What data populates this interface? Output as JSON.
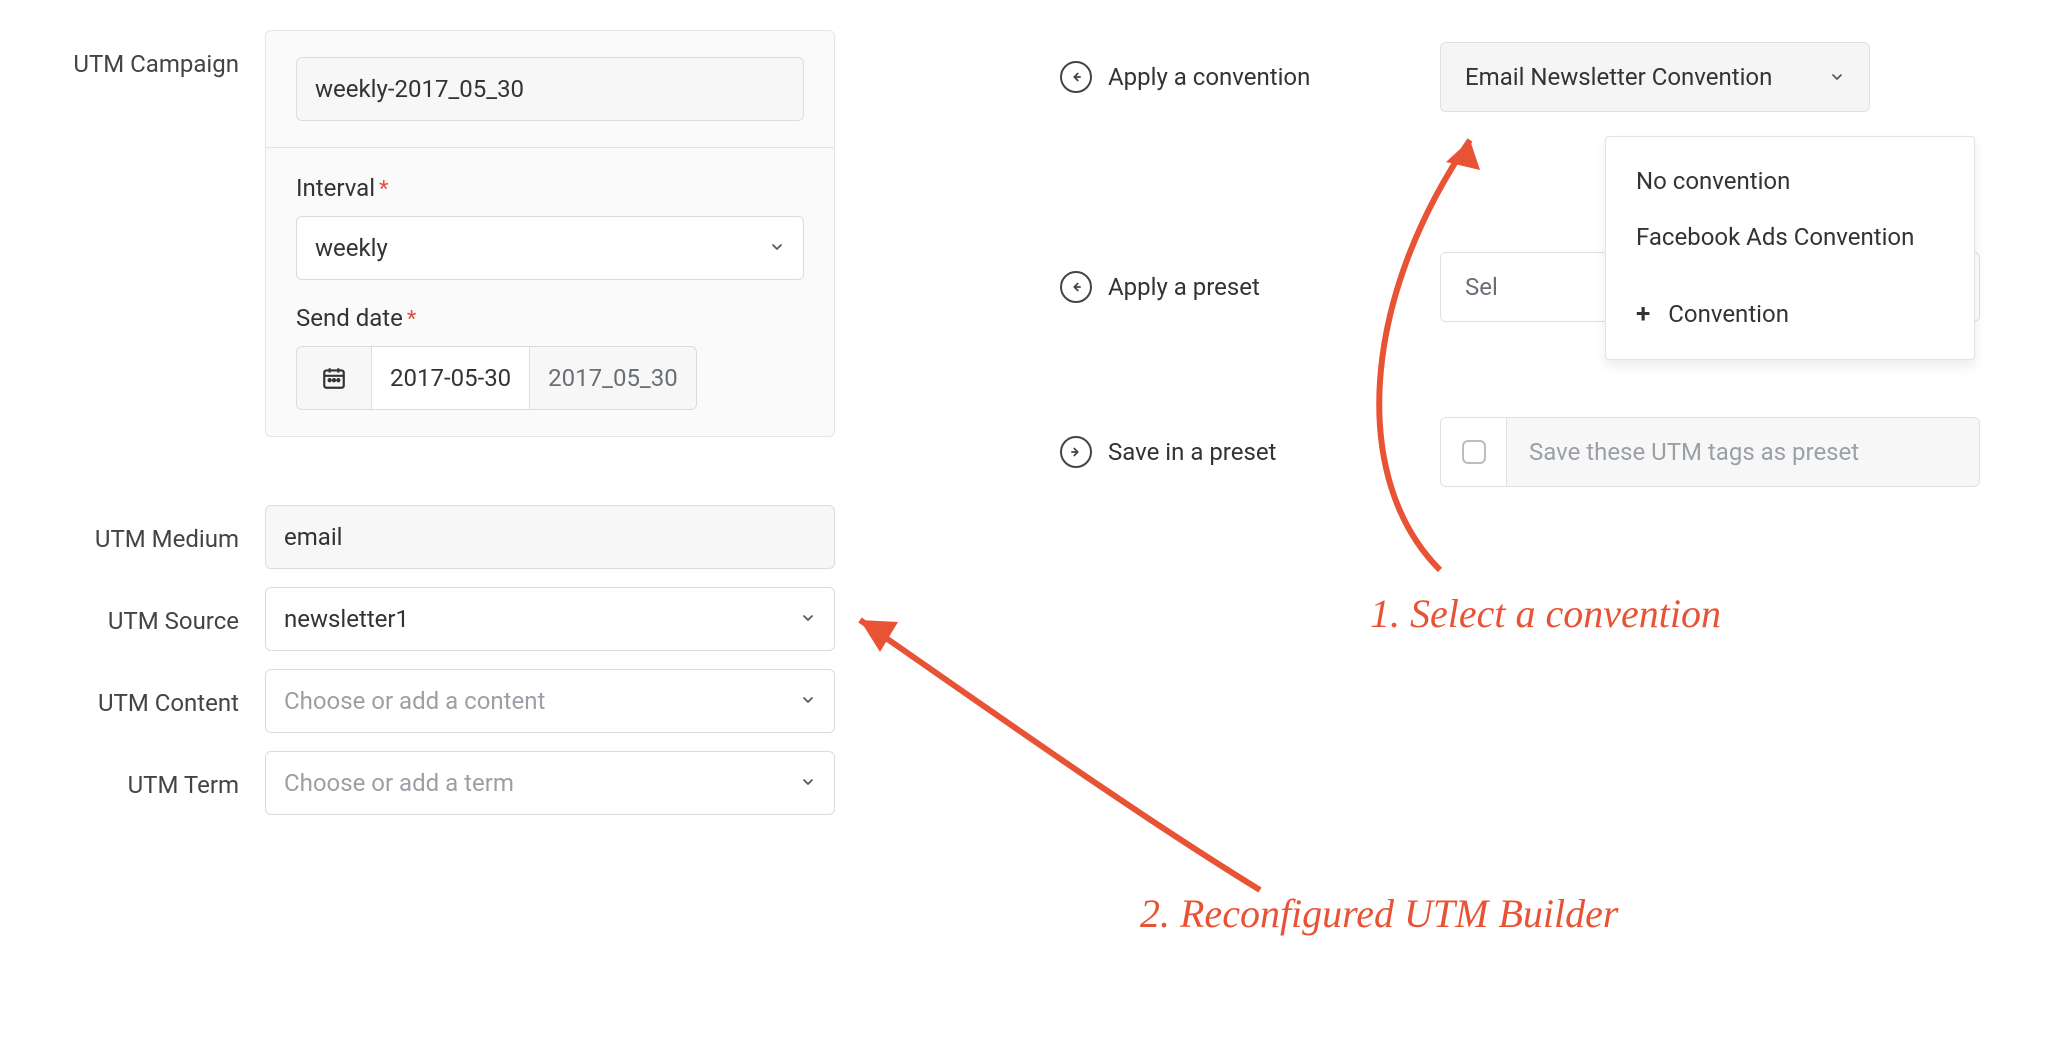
{
  "left": {
    "utm_campaign": {
      "label": "UTM Campaign",
      "value": "weekly-2017_05_30"
    },
    "interval": {
      "label": "Interval",
      "required": "*",
      "value": "weekly"
    },
    "send_date": {
      "label": "Send date",
      "required": "*",
      "date_value": "2017-05-30",
      "formatted": "2017_05_30"
    },
    "medium": {
      "label": "UTM Medium",
      "value": "email"
    },
    "source": {
      "label": "UTM Source",
      "value": "newsletter1"
    },
    "content": {
      "label": "UTM Content",
      "placeholder": "Choose or add a content"
    },
    "term": {
      "label": "UTM Term",
      "placeholder": "Choose or add a term"
    }
  },
  "right": {
    "convention": {
      "label": "Apply a convention",
      "selected": "Email Newsletter Convention",
      "options": {
        "none": "No convention",
        "fb": "Facebook Ads Convention",
        "add": "Convention"
      }
    },
    "preset": {
      "label": "Apply a preset",
      "partial": "Sel"
    },
    "save": {
      "label": "Save in a preset",
      "placeholder": "Save these UTM tags as preset"
    }
  },
  "anno": {
    "step1": "1. Select a convention",
    "step2": "2. Reconfigured UTM Builder"
  }
}
